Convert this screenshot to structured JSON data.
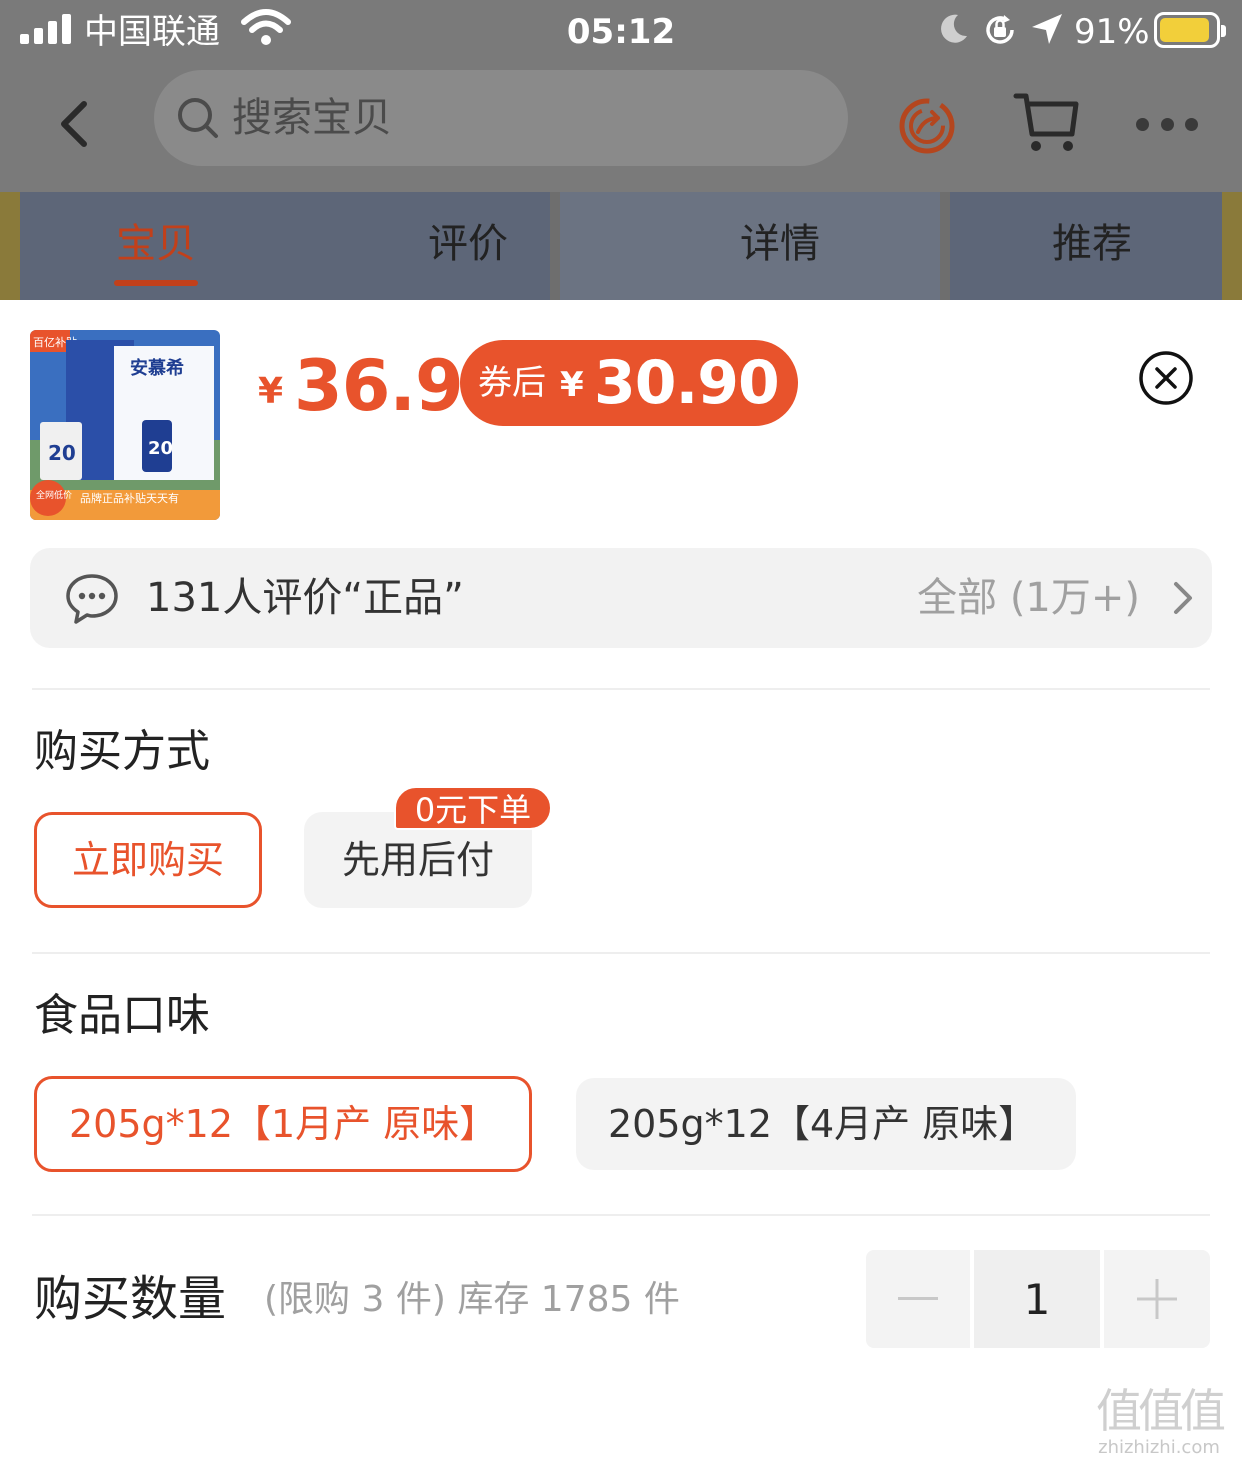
{
  "status_bar": {
    "carrier": "中国联通",
    "time": "05:12",
    "battery_pct": "91%",
    "battery_level": 0.91,
    "battery_color": "#f2cf3a"
  },
  "nav": {
    "search_placeholder": "搜索宝贝",
    "share_icon": "share-refresh-icon",
    "cart_icon": "cart-icon",
    "more_icon": "more-icon"
  },
  "tabs": [
    {
      "label": "宝贝",
      "active": true
    },
    {
      "label": "评价",
      "active": false
    },
    {
      "label": "详情",
      "active": false
    },
    {
      "label": "推荐",
      "active": false
    }
  ],
  "product": {
    "thumb_brand": "安慕希",
    "thumb_banner": "品牌正品补贴天天有",
    "thumb_badge_top": "百亿补贴",
    "thumb_badge_corner": "全网低价",
    "price_symbol": "¥",
    "price": "36.9",
    "coupon_label": "券后",
    "coupon_symbol": "¥",
    "coupon_price": "30.90"
  },
  "review": {
    "summary": "131人评价“正品”",
    "all_label": "全部 (1万+)"
  },
  "purchase_method": {
    "title": "购买方式",
    "options": [
      {
        "label": "立即购买",
        "selected": true
      },
      {
        "label": "先用后付",
        "selected": false,
        "badge": "0元下单"
      }
    ]
  },
  "flavor": {
    "title": "食品口味",
    "options": [
      {
        "label": "205g*12【1月产 原味】",
        "selected": true
      },
      {
        "label": "205g*12【4月产 原味】",
        "selected": false
      }
    ]
  },
  "quantity": {
    "title": "购买数量",
    "note": "(限购 3 件) 库存 1785 件",
    "value": "1"
  },
  "watermark": {
    "logo": "值值值",
    "url": "zhizhizhi.com"
  },
  "colors": {
    "accent": "#e8532c",
    "tab_active": "#c2401a",
    "overlay": "#7a7a7a"
  }
}
